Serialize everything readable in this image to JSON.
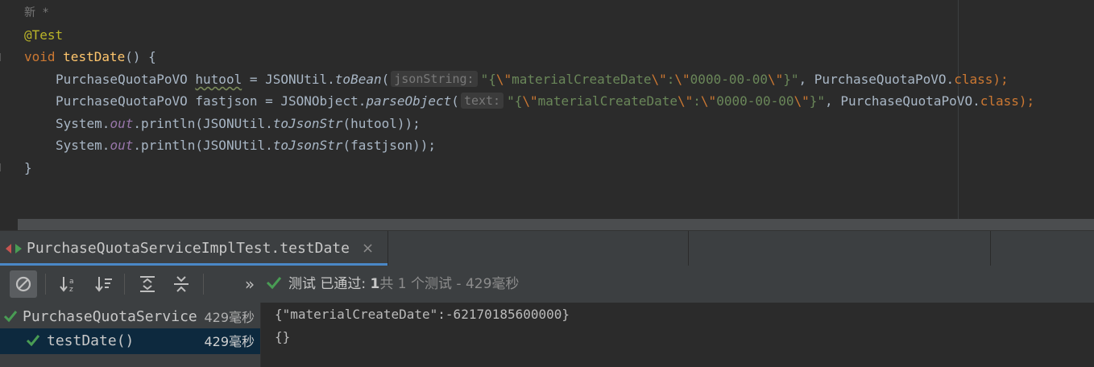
{
  "editor": {
    "meta_line": "新 *",
    "annotation": "@Test",
    "method_kw": "void",
    "method_name": "testDate",
    "method_rest": "() {",
    "line_hutool": {
      "type": "PurchaseQuotaPoVO",
      "var": "hutool",
      "eq": " = JSONUtil.",
      "call": "toBean",
      "open": "(",
      "hint": "jsonString:",
      "str_q1": "\"{",
      "esc1": "\\\"",
      "str_mid1": "materialCreateDate",
      "esc2": "\\\"",
      "str_mid2": ":",
      "esc3": "\\\"",
      "str_mid3": "0000-00-00",
      "esc4": "\\\"",
      "str_end": "}\"",
      "rest": ", PurchaseQuotaPoVO.",
      "cls": "class",
      "close": ");"
    },
    "line_fastjson": {
      "type": "PurchaseQuotaPoVO",
      "var": "fastjson",
      "eq": " = JSONObject.",
      "call": "parseObject",
      "open": "(",
      "hint": "text:",
      "str_q1": "\"{",
      "esc1": "\\\"",
      "str_mid1": "materialCreateDate",
      "esc2": "\\\"",
      "str_mid2": ":",
      "esc3": "\\\"",
      "str_mid3": "0000-00-00",
      "esc4": "\\\"",
      "str_end": "}\"",
      "rest": ", PurchaseQuotaPoVO.",
      "cls": "class",
      "close": ");"
    },
    "line_print1": {
      "pre": "System.",
      "field": "out",
      "mid": ".println(JSONUtil.",
      "call": "toJsonStr",
      "arg": "(hutool));"
    },
    "line_print2": {
      "pre": "System.",
      "field": "out",
      "mid": ".println(JSONUtil.",
      "call": "toJsonStr",
      "arg": "(fastjson));"
    },
    "closing_brace": "}"
  },
  "run_panel": {
    "tab_label": "PurchaseQuotaServiceImplTest.testDate",
    "tab_close": "×",
    "overflow_chevron": "»",
    "status": {
      "prefix": "测试 已通过: ",
      "passed": "1",
      "suffix": "共 1 个测试 - 429毫秒"
    },
    "tree": [
      {
        "label": "PurchaseQuotaService",
        "time": "429毫秒"
      },
      {
        "label": "testDate()",
        "time": "429毫秒"
      }
    ],
    "console": [
      "{\"materialCreateDate\":-62170185600000}",
      "{}"
    ],
    "colors": {
      "accent": "#4a88c7",
      "pass": "#499c54"
    }
  }
}
